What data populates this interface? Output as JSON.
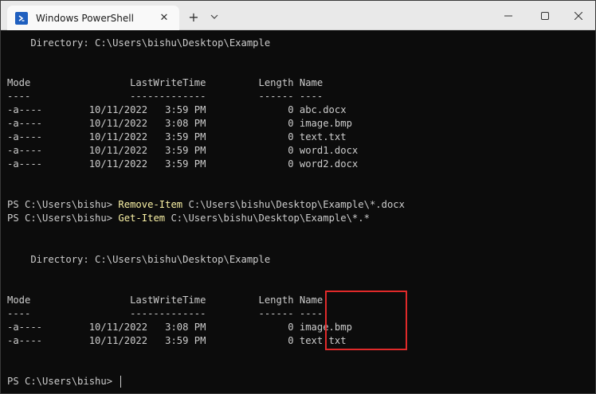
{
  "window": {
    "tab_title": "Windows PowerShell",
    "new_tab_label": "+",
    "tab_close_label": "✕"
  },
  "terminal": {
    "directory_line_1": "    Directory: C:\\Users\\bishu\\Desktop\\Example",
    "header_1": "Mode                 LastWriteTime         Length Name",
    "divider_1": "----                 -------------         ------ ----",
    "listing_1": [
      "-a----        10/11/2022   3:59 PM              0 abc.docx",
      "-a----        10/11/2022   3:08 PM              0 image.bmp",
      "-a----        10/11/2022   3:59 PM              0 text.txt",
      "-a----        10/11/2022   3:59 PM              0 word1.docx",
      "-a----        10/11/2022   3:59 PM              0 word2.docx"
    ],
    "prompt_1": "PS C:\\Users\\bishu> ",
    "command_1_name": "Remove-Item",
    "command_1_args": " C:\\Users\\bishu\\Desktop\\Example\\*.docx",
    "prompt_2": "PS C:\\Users\\bishu> ",
    "command_2_name": "Get-Item",
    "command_2_args": " C:\\Users\\bishu\\Desktop\\Example\\*.*",
    "directory_line_2": "    Directory: C:\\Users\\bishu\\Desktop\\Example",
    "header_2": "Mode                 LastWriteTime         Length Name",
    "divider_2": "----                 -------------         ------ ----",
    "listing_2": [
      "-a----        10/11/2022   3:08 PM              0 image.bmp",
      "-a----        10/11/2022   3:59 PM              0 text.txt"
    ],
    "prompt_3": "PS C:\\Users\\bishu> "
  },
  "colors": {
    "background": "#0c0c0c",
    "text": "#cccccc",
    "command": "#f9f1a5",
    "highlight_box": "#e02a2a"
  },
  "icons": {
    "tab_icon": "powershell-icon",
    "dropdown": "chevron-down-icon",
    "minimize": "minimize-icon",
    "maximize": "maximize-icon",
    "close": "close-icon"
  }
}
